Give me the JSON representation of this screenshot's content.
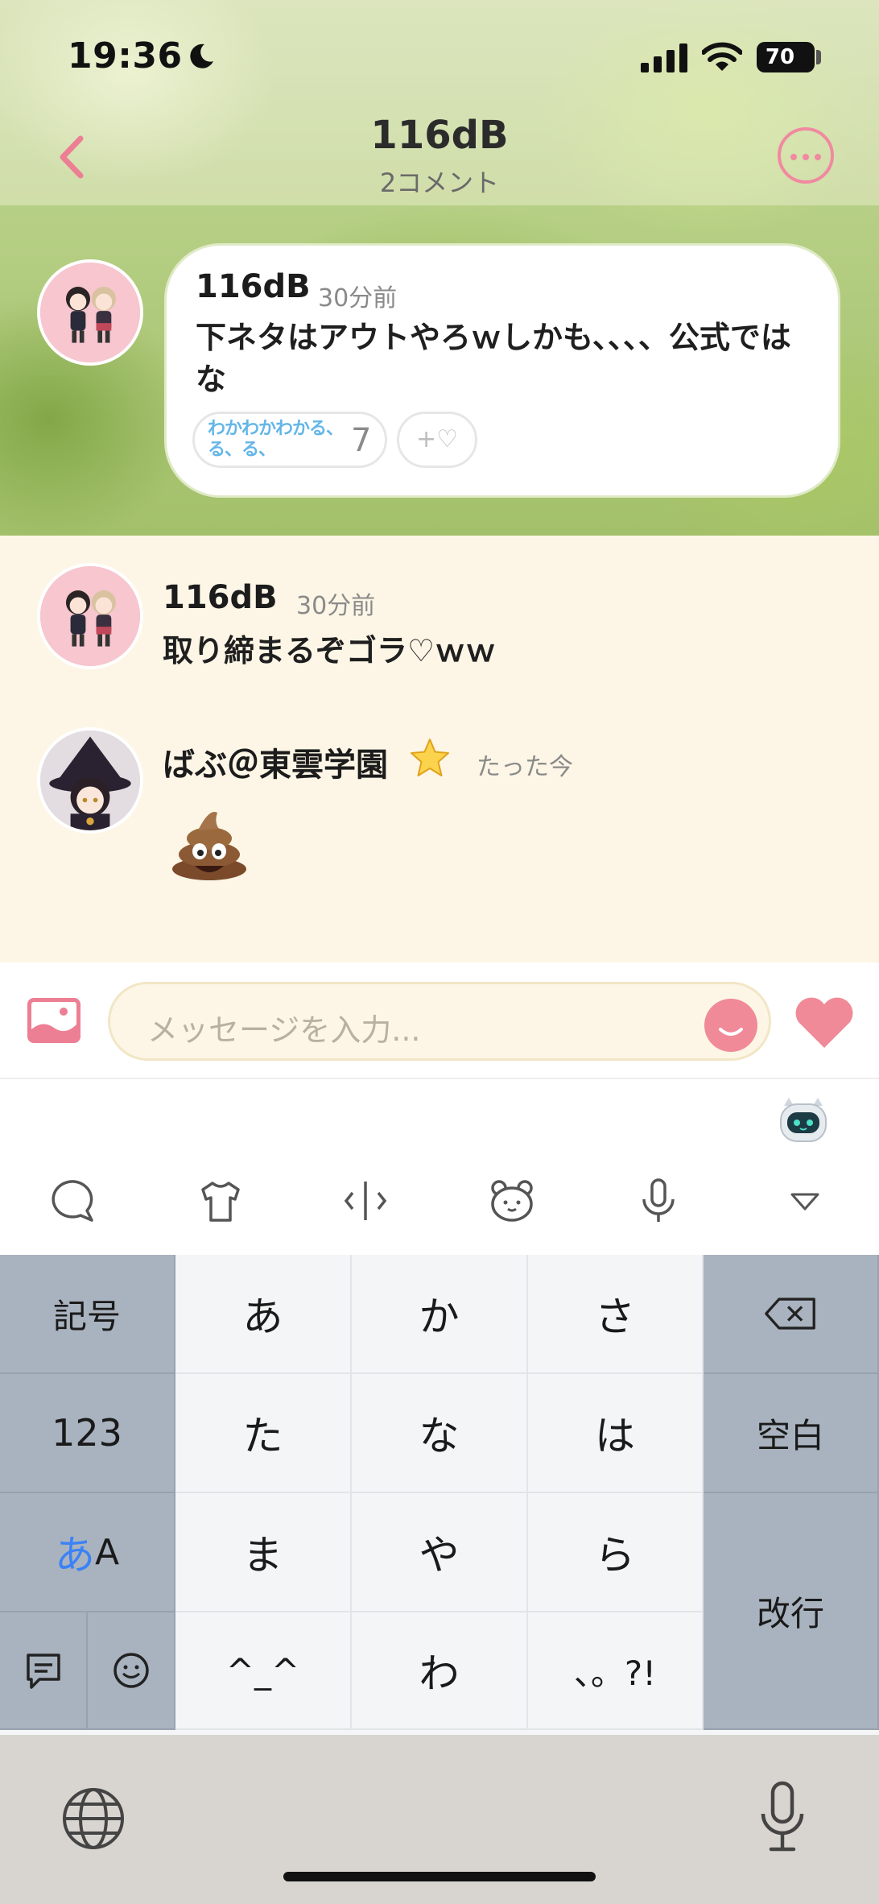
{
  "status_bar": {
    "time": "19:36",
    "battery": "70"
  },
  "nav": {
    "title": "116dB",
    "subtitle": "2コメント"
  },
  "parent_comment": {
    "author": "116dB",
    "time": "30分前",
    "text": "下ネタはアウトやろｗしかも、、、、公式ではな",
    "reaction_stamp": "わかわかわかる、る、る、",
    "reaction_count": "7",
    "add_reaction_label": "+♡"
  },
  "replies": [
    {
      "author": "116dB",
      "time": "30分前",
      "text": "取り締まるぞゴラ♡ｗｗ"
    },
    {
      "author": "ばぶ＠東雲学園",
      "time": "たった今",
      "text": ""
    }
  ],
  "input": {
    "placeholder": "メッセージを入力..."
  },
  "keyboard": {
    "symbols": "記号",
    "numbers": "123",
    "mode_hira": "あ",
    "mode_alpha": "A",
    "space": "空白",
    "enter": "改行",
    "rows": [
      [
        "あ",
        "か",
        "さ"
      ],
      [
        "た",
        "な",
        "は"
      ],
      [
        "ま",
        "や",
        "ら"
      ],
      [
        "^_^",
        "わ",
        "、。?!"
      ]
    ]
  },
  "colors": {
    "accent": "#f08a98",
    "reaction_blue": "#64b6e8",
    "reply_bg": "#fdf6e6",
    "keyboard_func": "#a9b3bf"
  }
}
